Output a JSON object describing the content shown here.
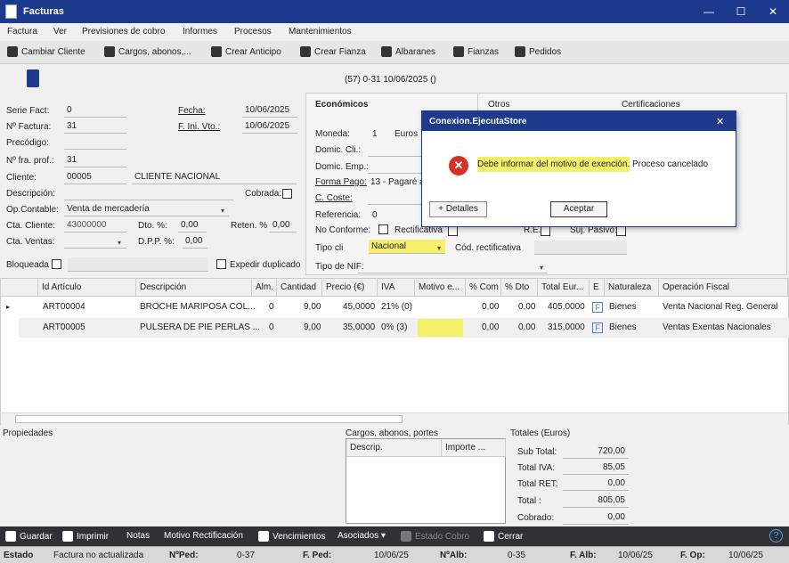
{
  "window": {
    "title": "Facturas",
    "min": "—",
    "max": "☐",
    "close": "✕"
  },
  "menu": [
    "Factura",
    "Ver",
    "Previsiones de cobro",
    "Informes",
    "Procesos",
    "Mantenimientos"
  ],
  "toolbar": [
    "Cambiar Cliente",
    "Cargos, abonos,...",
    "Crear Anticipo",
    "Crear Fianza",
    "Albaranes",
    "Fianzas",
    "Pedidos"
  ],
  "header_info": "(57) 0-31  10/06/2025  ()",
  "form": {
    "serie_label": "Serie Fact:",
    "serie": "0",
    "nfact_label": "Nº Factura:",
    "nfact": "31",
    "precodigo_label": "Precódigo:",
    "nfraprof_label": "Nº fra. prof.:",
    "nfraprof": "31",
    "cliente_label": "Cliente:",
    "cliente_code": "00005",
    "cliente_name": "CLIENTE NACIONAL",
    "descripcion_label": "Descripción:",
    "cobrada_label": "Cobrada:",
    "opcontable_label": "Op.Contable:",
    "opcontable": "Venta de mercadería",
    "ctacliente_label": "Cta. Cliente:",
    "ctacliente": "43000000",
    "dto_label": "Dto. %:",
    "dto": "0,00",
    "reten_label": "Reten. %",
    "reten": "0,00",
    "ctaventas_label": "Cta. Ventas:",
    "dpp_label": "D.P.P. %:",
    "dpp": "0,00",
    "bloqueada_label": "Bloqueada",
    "expedir_label": "Expedir duplicado",
    "fecha_label": "Fecha:",
    "fecha": "10/06/2025",
    "finivto_label": "F. Ini. Vto.:",
    "finivto": "10/06/2025"
  },
  "tabs": [
    "Económicos",
    "Otros",
    "Certificaciones"
  ],
  "economicos": {
    "moneda_label": "Moneda:",
    "moneda_code": "1",
    "moneda": "Euros",
    "domiccli_label": "Domic. Cli.:",
    "domicemp_label": "Domic. Emp.:",
    "formapago_label": "Forma Pago:",
    "formapago": "13 - Pagaré a",
    "ccoste_label": "C. Coste:",
    "referencia_label": "Referencia:",
    "referencia": "0",
    "noconforme_label": "No Conforme:",
    "rectificativa_label": "Rectificativa",
    "re_label": "R.E.:",
    "sujpasivo_label": "Suj. Pasivo:",
    "tipocli_label": "Tipo cli",
    "tipocli": "Nacional",
    "codrect_label": "Cód. rectificativa",
    "tiponif_label": "Tipo de NIF:"
  },
  "grid": {
    "headers": [
      "Id Artículo",
      "Descripción",
      "Alm.",
      "Cantidad",
      "Precio (€)",
      "IVA",
      "Motivo e...",
      "% Com",
      "% Dto",
      "Total Eur...",
      "E",
      "Naturaleza",
      "Operación Fiscal"
    ],
    "rows": [
      [
        "ART00004",
        "BROCHE MARIPOSA COL...",
        "0",
        "9,00",
        "45,0000",
        "21% (0)",
        "",
        "0,00",
        "0,00",
        "405,0000",
        "F",
        "Bienes",
        "Venta Nacional Reg. General"
      ],
      [
        "ART00005",
        "PULSERA DE PIE PERLAS ...",
        "0",
        "9,00",
        "35,0000",
        "0% (3)",
        "",
        "0,00",
        "0,00",
        "315,0000",
        "F",
        "Bienes",
        "Ventas Exentas Nacionales"
      ]
    ]
  },
  "propiedades": "Propiedades",
  "cargos": {
    "title": "Cargos, abonos, portes",
    "h1": "Descrip.",
    "h2": "Importe ..."
  },
  "totales": {
    "title": "Totales (Euros)",
    "subtotal_label": "Sub Total:",
    "subtotal": "720,00",
    "iva_label": "Total IVA:",
    "iva": "85,05",
    "ret_label": "Total RET:",
    "ret": "0,00",
    "total_label": "Total :",
    "total": "805,05",
    "cobrado_label": "Cobrado:",
    "cobrado": "0,00"
  },
  "dialog": {
    "title": "Conexion.EjecutaStore",
    "close": "✕",
    "msg_highlight": "Debe informar del motivo de exención.",
    "msg_rest": " Proceso cancelado",
    "details": "+ Detalles",
    "ok": "Aceptar"
  },
  "bottombar": [
    "Guardar",
    "Imprimir",
    "Notas",
    "Motivo Rectificación",
    "Vencimientos",
    "Asociados ▾",
    "Estado Cobro",
    "Cerrar",
    "?"
  ],
  "status": {
    "estado_label": "Estado",
    "estado": "Factura no actualizada",
    "nped_label": "NºPed:",
    "nped": "0-37",
    "fped_label": "F. Ped:",
    "fped": "10/06/25",
    "nalb_label": "NºAlb:",
    "nalb": "0-35",
    "falb_label": "F. Alb:",
    "falb": "10/06/25",
    "fop_label": "F. Op:",
    "fop": "10/06/25"
  },
  "colors": {
    "titlebar": "#1e3a8c",
    "highlight": "#f5f06a",
    "error": "#d93025"
  }
}
